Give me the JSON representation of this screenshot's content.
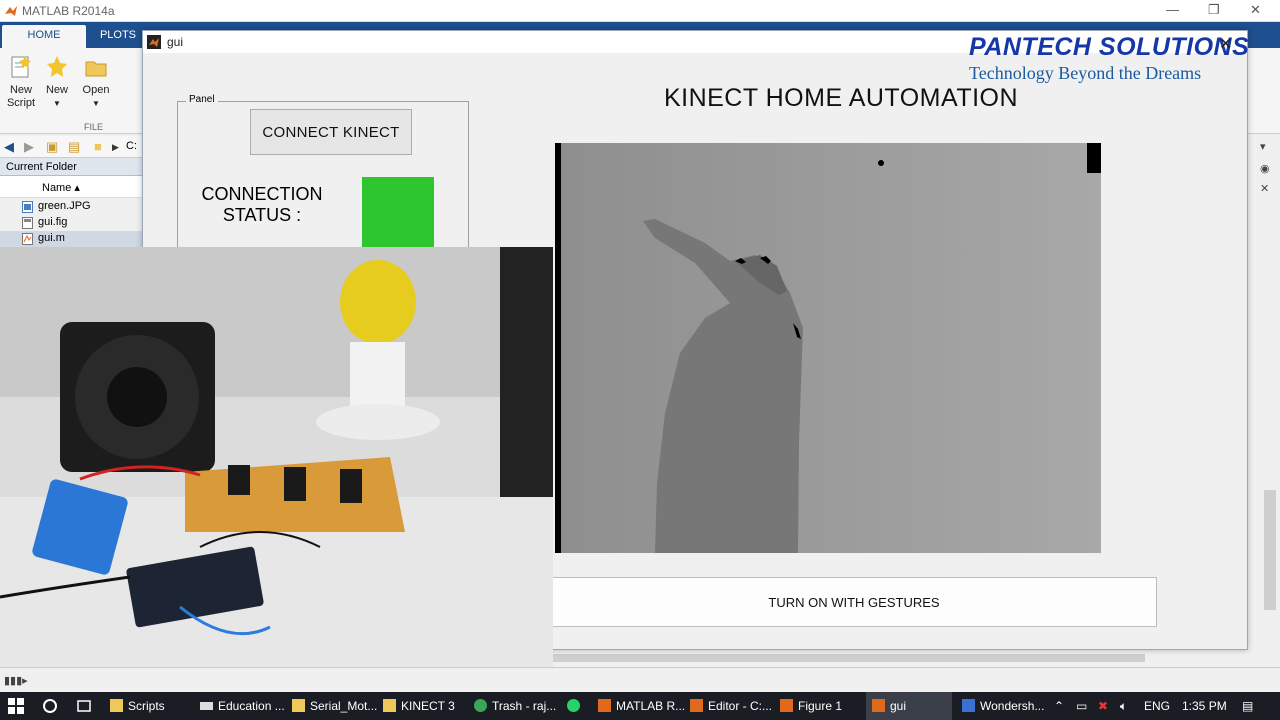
{
  "matlab": {
    "title": "MATLAB R2014a",
    "tabs": [
      "HOME",
      "PLOTS"
    ],
    "ribbon_buttons": [
      {
        "label_line1": "New",
        "label_line2": "Script"
      },
      {
        "label_line1": "New",
        "label_line2": ""
      },
      {
        "label_line1": "Open",
        "label_line2": ""
      }
    ],
    "ribbon_group": "FILE",
    "address_path": "C:",
    "current_folder_header": "Current Folder",
    "column_name": "Name ▴",
    "files": [
      "green.JPG",
      "gui.fig",
      "gui.m"
    ]
  },
  "gui": {
    "window_title": "gui",
    "panel_label": "Panel",
    "connect_button": "CONNECT KINECT",
    "connection_status_line1": "CONNECTION",
    "connection_status_line2": "STATUS :",
    "connection_status_color": "#2ec62e",
    "app_title": "KINECT HOME AUTOMATION",
    "brand_name": "PANTECH SOLUTIONS",
    "brand_tagline": "Technology Beyond the Dreams",
    "gesture_button": "TURN ON WITH GESTURES"
  },
  "taskbar": {
    "items": [
      {
        "label": "Scripts",
        "icon": "folder-icon"
      },
      {
        "label": "Education ...",
        "icon": "drive-icon"
      },
      {
        "label": "Serial_Mot...",
        "icon": "folder-icon"
      },
      {
        "label": "KINECT 3",
        "icon": "folder-icon"
      },
      {
        "label": "Trash - raj...",
        "icon": "chrome-icon"
      },
      {
        "label": "",
        "icon": "whatsapp-icon"
      },
      {
        "label": "MATLAB R...",
        "icon": "matlab-icon"
      },
      {
        "label": "Editor - C:...",
        "icon": "matlab-icon"
      },
      {
        "label": "Figure 1",
        "icon": "matlab-icon"
      },
      {
        "label": "gui",
        "icon": "matlab-icon"
      },
      {
        "label": "Wondersh...",
        "icon": "wondershare-icon"
      }
    ],
    "language": "ENG",
    "time": "1:35 PM"
  }
}
